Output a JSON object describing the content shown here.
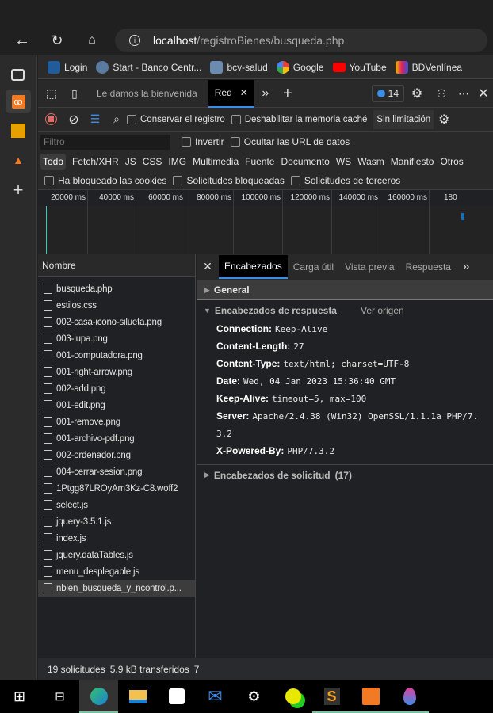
{
  "browser": {
    "url_host": "localhost",
    "url_path": "/registroBienes/busqueda.php"
  },
  "bookmarks": [
    {
      "label": "Login",
      "color": "#1f5c99"
    },
    {
      "label": "Start - Banco Centr...",
      "color": "#5a7aa0"
    },
    {
      "label": "bcv-salud",
      "color": "#6b8bb0"
    },
    {
      "label": "Google",
      "color": "#4285f4"
    },
    {
      "label": "YouTube",
      "color": "#ff0000"
    },
    {
      "label": "BDVenlínea",
      "color": "#f0c000"
    }
  ],
  "devtools": {
    "tabs": {
      "welcome": "Le damos la bienvenida",
      "network": "Red",
      "issues_count": "14"
    },
    "toolbar": {
      "preserve_log": "Conservar el registro",
      "disable_cache": "Deshabilitar la memoria caché",
      "throttling": "Sin limitación"
    },
    "filter": {
      "placeholder": "Filtro",
      "invert": "Invertir",
      "hide_data_urls": "Ocultar las URL de datos"
    },
    "types": [
      "Todo",
      "Fetch/XHR",
      "JS",
      "CSS",
      "IMG",
      "Multimedia",
      "Fuente",
      "Documento",
      "WS",
      "Wasm",
      "Manifiesto",
      "Otros"
    ],
    "blocked": {
      "cookies": "Ha bloqueado las cookies",
      "requests": "Solicitudes bloqueadas",
      "third_party": "Solicitudes de terceros"
    },
    "timeline_ticks": [
      "20000 ms",
      "40000 ms",
      "60000 ms",
      "80000 ms",
      "100000 ms",
      "120000 ms",
      "140000 ms",
      "160000 ms",
      "180"
    ],
    "list_header": "Nombre",
    "requests": [
      "busqueda.php",
      "estilos.css",
      "002-casa-icono-silueta.png",
      "003-lupa.png",
      "001-computadora.png",
      "001-right-arrow.png",
      "002-add.png",
      "001-edit.png",
      "001-remove.png",
      "001-archivo-pdf.png",
      "002-ordenador.png",
      "004-cerrar-sesion.png",
      "1Ptgg87LROyAm3Kz-C8.woff2",
      "select.js",
      "jquery-3.5.1.js",
      "index.js",
      "jquery.dataTables.js",
      "menu_desplegable.js",
      "nbien_busqueda_y_ncontrol.p..."
    ],
    "detail_tabs": [
      "Encabezados",
      "Carga útil",
      "Vista previa",
      "Respuesta"
    ],
    "general": "General",
    "response_headers_title": "Encabezados de respuesta",
    "view_source": "Ver origen",
    "response_headers": [
      {
        "k": "Connection:",
        "v": "Keep-Alive"
      },
      {
        "k": "Content-Length:",
        "v": "27"
      },
      {
        "k": "Content-Type:",
        "v": "text/html; charset=UTF-8"
      },
      {
        "k": "Date:",
        "v": "Wed, 04 Jan 2023 15:36:40 GMT"
      },
      {
        "k": "Keep-Alive:",
        "v": "timeout=5, max=100"
      },
      {
        "k": "Server:",
        "v": "Apache/2.4.38 (Win32) OpenSSL/1.1.1a PHP/7.",
        "v2": "3.2"
      },
      {
        "k": "X-Powered-By:",
        "v": "PHP/7.3.2"
      }
    ],
    "request_headers_title": "Encabezados de solicitud",
    "request_headers_count": "(17)",
    "status": {
      "requests": "19 solicitudes",
      "transferred": "5.9 kB transferidos",
      "more": "7"
    }
  }
}
